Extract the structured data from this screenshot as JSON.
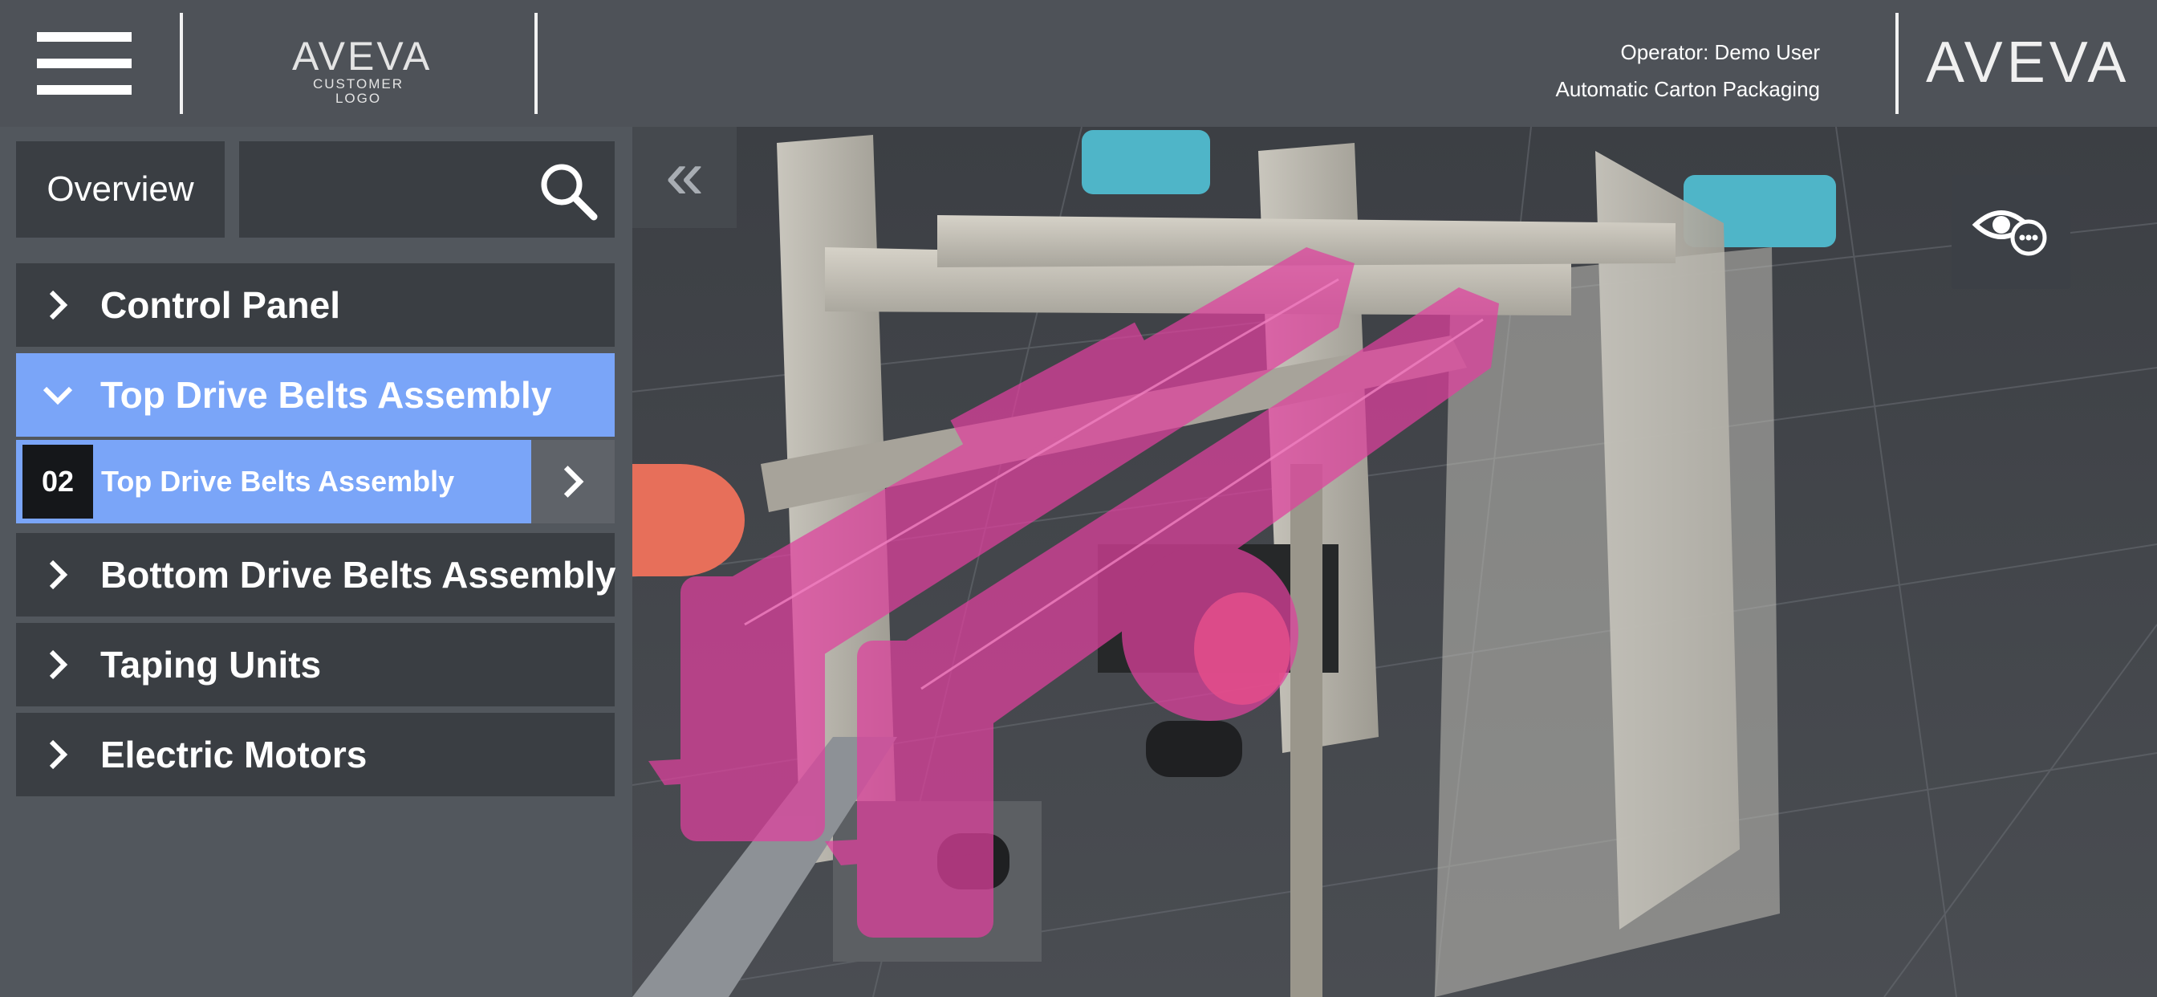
{
  "header": {
    "customer_logo_word": "AVEVA",
    "customer_logo_sub": "CUSTOMER LOGO",
    "operator_label": "Operator: Demo User",
    "process_name": "Automatic Carton Packaging",
    "brand_logo": "AVEVA"
  },
  "sidebar": {
    "overview_label": "Overview",
    "search": {
      "value": "",
      "placeholder": ""
    },
    "items": [
      {
        "label": "Control Panel",
        "expanded": false
      },
      {
        "label": "Top Drive Belts Assembly",
        "expanded": true
      },
      {
        "label": "Bottom Drive Belts Assembly",
        "expanded": false
      },
      {
        "label": "Taping Units",
        "expanded": false
      },
      {
        "label": "Electric Motors",
        "expanded": false
      }
    ],
    "subitem": {
      "number": "02",
      "label": "Top Drive Belts Assembly"
    }
  },
  "viewport": {
    "collapse_glyph": "«",
    "icons": [
      "menu-icon",
      "search-icon",
      "chevron-right-icon",
      "chevron-down-icon",
      "visibility-options-icon",
      "double-chevron-left-icon"
    ],
    "colors": {
      "highlight": "#e0409e",
      "accent_blue": "#7aa5f8",
      "motor_teal": "#4fb5c8",
      "roller_orange": "#e76f5a"
    }
  }
}
